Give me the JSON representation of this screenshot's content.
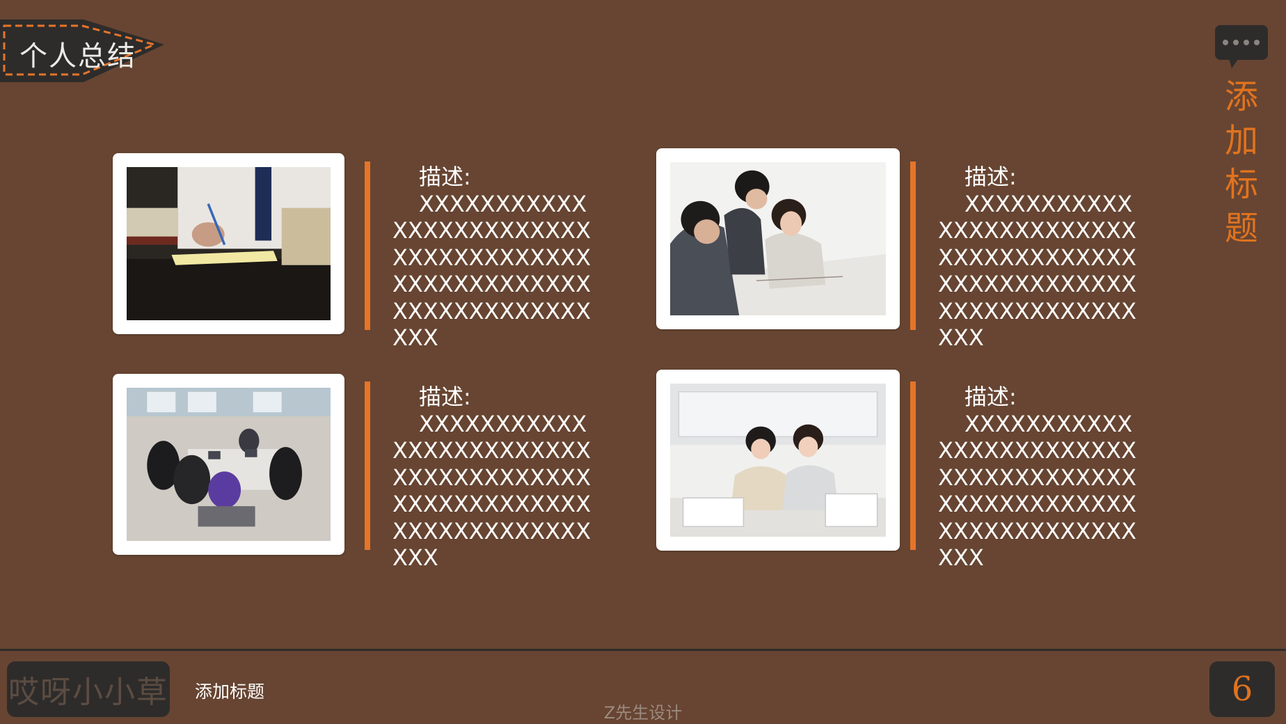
{
  "header": {
    "tag_label": "个人总结"
  },
  "side_title": [
    "添",
    "加",
    "标",
    "题"
  ],
  "cards": [
    {
      "label": "描述:",
      "body": "XXXXXXXXXXXXXXXXXXXXXXXXXXXXXXXXXXXXXXXXXXXXXXXXXXXXXXXXXXXXXXXXXX",
      "photo": "person-writing-at-desk-photo"
    },
    {
      "label": "描述:",
      "body": "XXXXXXXXXXXXXXXXXXXXXXXXXXXXXXXXXXXXXXXXXXXXXXXXXXXXXXXXXXXXXXXXXX",
      "photo": "business-meeting-photo"
    },
    {
      "label": "描述:",
      "body": "XXXXXXXXXXXXXXXXXXXXXXXXXXXXXXXXXXXXXXXXXXXXXXXXXXXXXXXXXXXXXXXXXX",
      "photo": "group-study-photo"
    },
    {
      "label": "描述:",
      "body": "XXXXXXXXXXXXXXXXXXXXXXXXXXXXXXXXXXXXXXXXXXXXXXXXXXXXXXXXXXXXXXXXXX",
      "photo": "office-computer-photo"
    }
  ],
  "footer": {
    "author": "哎呀小小草",
    "title": "添加标题",
    "designer": "Z先生设计",
    "page_number": "6"
  },
  "colors": {
    "background": "#674532",
    "accent": "#e5752a",
    "dark": "#2e2c2b"
  },
  "icons": [
    "chat-bubble-icon"
  ]
}
